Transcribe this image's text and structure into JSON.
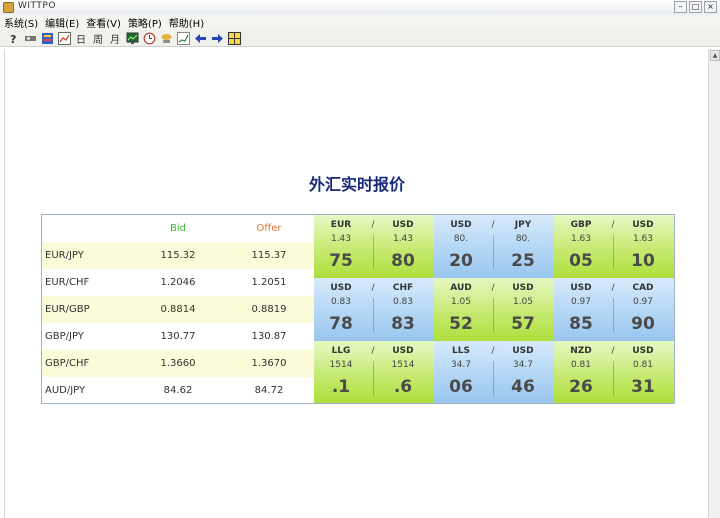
{
  "window": {
    "title": "WITTPO"
  },
  "menu": [
    {
      "label": "系统(S)"
    },
    {
      "label": "编辑(E)"
    },
    {
      "label": "查看(V)"
    },
    {
      "label": "策略(P)"
    },
    {
      "label": "帮助(H)"
    }
  ],
  "toolbar": {
    "day": "日",
    "week": "周",
    "month": "月"
  },
  "page": {
    "title": "外汇实时报价"
  },
  "quotes": {
    "header": {
      "bid": "Bid",
      "offer": "Offer"
    },
    "rows": [
      {
        "pair": "EUR/JPY",
        "bid": "115.32",
        "offer": "115.37"
      },
      {
        "pair": "EUR/CHF",
        "bid": "1.2046",
        "offer": "1.2051"
      },
      {
        "pair": "EUR/GBP",
        "bid": "0.8814",
        "offer": "0.8819"
      },
      {
        "pair": "GBP/JPY",
        "bid": "130.77",
        "offer": "130.87"
      },
      {
        "pair": "GBP/CHF",
        "bid": "1.3660",
        "offer": "1.3670"
      },
      {
        "pair": "AUD/JPY",
        "bid": "84.62",
        "offer": "84.72"
      }
    ]
  },
  "tiles": [
    {
      "left": "EUR",
      "right": "USD",
      "sep": "/",
      "left_small": "1.43",
      "right_small": "1.43",
      "left_big": "75",
      "right_big": "80",
      "color": "green"
    },
    {
      "left": "USD",
      "right": "JPY",
      "sep": "/",
      "left_small": "80.",
      "right_small": "80.",
      "left_big": "20",
      "right_big": "25",
      "color": "blue"
    },
    {
      "left": "GBP",
      "right": "USD",
      "sep": "/",
      "left_small": "1.63",
      "right_small": "1.63",
      "left_big": "05",
      "right_big": "10",
      "color": "green"
    },
    {
      "left": "USD",
      "right": "CHF",
      "sep": "/",
      "left_small": "0.83",
      "right_small": "0.83",
      "left_big": "78",
      "right_big": "83",
      "color": "blue"
    },
    {
      "left": "AUD",
      "right": "USD",
      "sep": "/",
      "left_small": "1.05",
      "right_small": "1.05",
      "left_big": "52",
      "right_big": "57",
      "color": "green"
    },
    {
      "left": "USD",
      "right": "CAD",
      "sep": "/",
      "left_small": "0.97",
      "right_small": "0.97",
      "left_big": "85",
      "right_big": "90",
      "color": "blue"
    },
    {
      "left": "LLG",
      "right": "USD",
      "sep": "/",
      "left_small": "1514",
      "right_small": "1514",
      "left_big": ".1",
      "right_big": ".6",
      "color": "green"
    },
    {
      "left": "LLS",
      "right": "USD",
      "sep": "/",
      "left_small": "34.7",
      "right_small": "34.7",
      "left_big": "06",
      "right_big": "46",
      "color": "blue"
    },
    {
      "left": "NZD",
      "right": "USD",
      "sep": "/",
      "left_small": "0.81",
      "right_small": "0.81",
      "left_big": "26",
      "right_big": "31",
      "color": "green"
    }
  ],
  "colors": {
    "tile_green": "#bfe66a",
    "tile_blue": "#aed2f3",
    "row_highlight": "#fbfbd9",
    "bid_header": "#3fae33",
    "offer_header": "#e0783a",
    "title": "#1a2a7a"
  }
}
